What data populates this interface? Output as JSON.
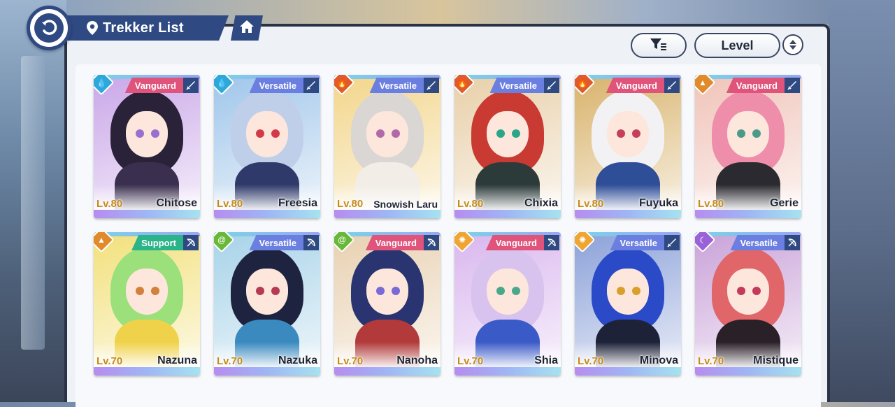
{
  "header": {
    "title": "Trekker List"
  },
  "toolbar": {
    "sort_label": "Level"
  },
  "trekkers": [
    {
      "name": "Chitose",
      "level": "Lv.80",
      "role": "Vanguard",
      "element_icon": "water-drop-icon",
      "elem_glyph": "💧",
      "weapon_icon": "sword-icon",
      "role_color": "#e0537a",
      "elem_color": "#2ea7d9",
      "hair": "#2a2238",
      "eye": "#9a6fd0",
      "outfit": "#3a2f4e",
      "bg": "#c9a6e8"
    },
    {
      "name": "Freesia",
      "level": "Lv.80",
      "role": "Versatile",
      "element_icon": "water-drop-icon",
      "elem_glyph": "💧",
      "weapon_icon": "sword-icon",
      "role_color": "#6b7fe0",
      "elem_color": "#2ea7d9",
      "hair": "#bfcfea",
      "eye": "#d23a4a",
      "outfit": "#2f3a6a",
      "bg": "#9fc5ea"
    },
    {
      "name": "Snowish Laru",
      "level": "Lv.80",
      "role": "Versatile",
      "element_icon": "fire-icon",
      "elem_glyph": "🔥",
      "weapon_icon": "sword-icon",
      "role_color": "#6b7fe0",
      "elem_color": "#e05a2a",
      "hair": "#d9d6d3",
      "eye": "#b06aa8",
      "outfit": "#f2ede6",
      "bg": "#f3d58a"
    },
    {
      "name": "Chixia",
      "level": "Lv.80",
      "role": "Versatile",
      "element_icon": "fire-icon",
      "elem_glyph": "🔥",
      "weapon_icon": "sword-icon",
      "role_color": "#6b7fe0",
      "elem_color": "#e05a2a",
      "hair": "#c83a32",
      "eye": "#2aa58a",
      "outfit": "#2c3a3a",
      "bg": "#e8cfa8"
    },
    {
      "name": "Fuyuka",
      "level": "Lv.80",
      "role": "Vanguard",
      "element_icon": "fire-icon",
      "elem_glyph": "🔥",
      "weapon_icon": "sword-icon",
      "role_color": "#e0537a",
      "elem_color": "#e05a2a",
      "hair": "#f2f2f4",
      "eye": "#c4405a",
      "outfit": "#2f4e98",
      "bg": "#d8b26a"
    },
    {
      "name": "Gerie",
      "level": "Lv.80",
      "role": "Vanguard",
      "element_icon": "earth-icon",
      "elem_glyph": "▲",
      "weapon_icon": "sword-icon",
      "role_color": "#e0537a",
      "elem_color": "#e08a2a",
      "hair": "#ee8eaa",
      "eye": "#4a9a8a",
      "outfit": "#2a2a30",
      "bg": "#f0c3b8"
    },
    {
      "name": "Nazuna",
      "level": "Lv.70",
      "role": "Support",
      "element_icon": "earth-icon",
      "elem_glyph": "▲",
      "weapon_icon": "bow-icon",
      "role_color": "#2bb38a",
      "elem_color": "#e08a2a",
      "hair": "#9be07a",
      "eye": "#d2803a",
      "outfit": "#f0d24a",
      "bg": "#f2e07a"
    },
    {
      "name": "Nazuka",
      "level": "Lv.70",
      "role": "Versatile",
      "element_icon": "wind-icon",
      "elem_glyph": "@",
      "weapon_icon": "bow-icon",
      "role_color": "#6b7fe0",
      "elem_color": "#6ab83a",
      "hair": "#1e2440",
      "eye": "#b63a52",
      "outfit": "#3a8ac0",
      "bg": "#a6d2e8"
    },
    {
      "name": "Nanoha",
      "level": "Lv.70",
      "role": "Vanguard",
      "element_icon": "wind-icon",
      "elem_glyph": "@",
      "weapon_icon": "bow-icon",
      "role_color": "#e0537a",
      "elem_color": "#6ab83a",
      "hair": "#2a3470",
      "eye": "#7a6ad8",
      "outfit": "#b23a3a",
      "bg": "#e8d0b0"
    },
    {
      "name": "Shia",
      "level": "Lv.70",
      "role": "Vanguard",
      "element_icon": "light-icon",
      "elem_glyph": "✺",
      "weapon_icon": "bow-icon",
      "role_color": "#e0537a",
      "elem_color": "#f0a432",
      "hair": "#d8c2ee",
      "eye": "#4aa88a",
      "outfit": "#3a5ac8",
      "bg": "#d9b6ee"
    },
    {
      "name": "Minova",
      "level": "Lv.70",
      "role": "Versatile",
      "element_icon": "light-icon",
      "elem_glyph": "✺",
      "weapon_icon": "sword-icon",
      "role_color": "#6b7fe0",
      "elem_color": "#f0a432",
      "hair": "#2a4ac8",
      "eye": "#d8a02a",
      "outfit": "#1e2238",
      "bg": "#8aa0d8"
    },
    {
      "name": "Mistique",
      "level": "Lv.70",
      "role": "Versatile",
      "element_icon": "dark-moon-icon",
      "elem_glyph": "☾",
      "weapon_icon": "bow-icon",
      "role_color": "#6b7fe0",
      "elem_color": "#9a62d8",
      "hair": "#e0666a",
      "eye": "#c43a5a",
      "outfit": "#2a2028",
      "bg": "#c9a2d8"
    }
  ]
}
